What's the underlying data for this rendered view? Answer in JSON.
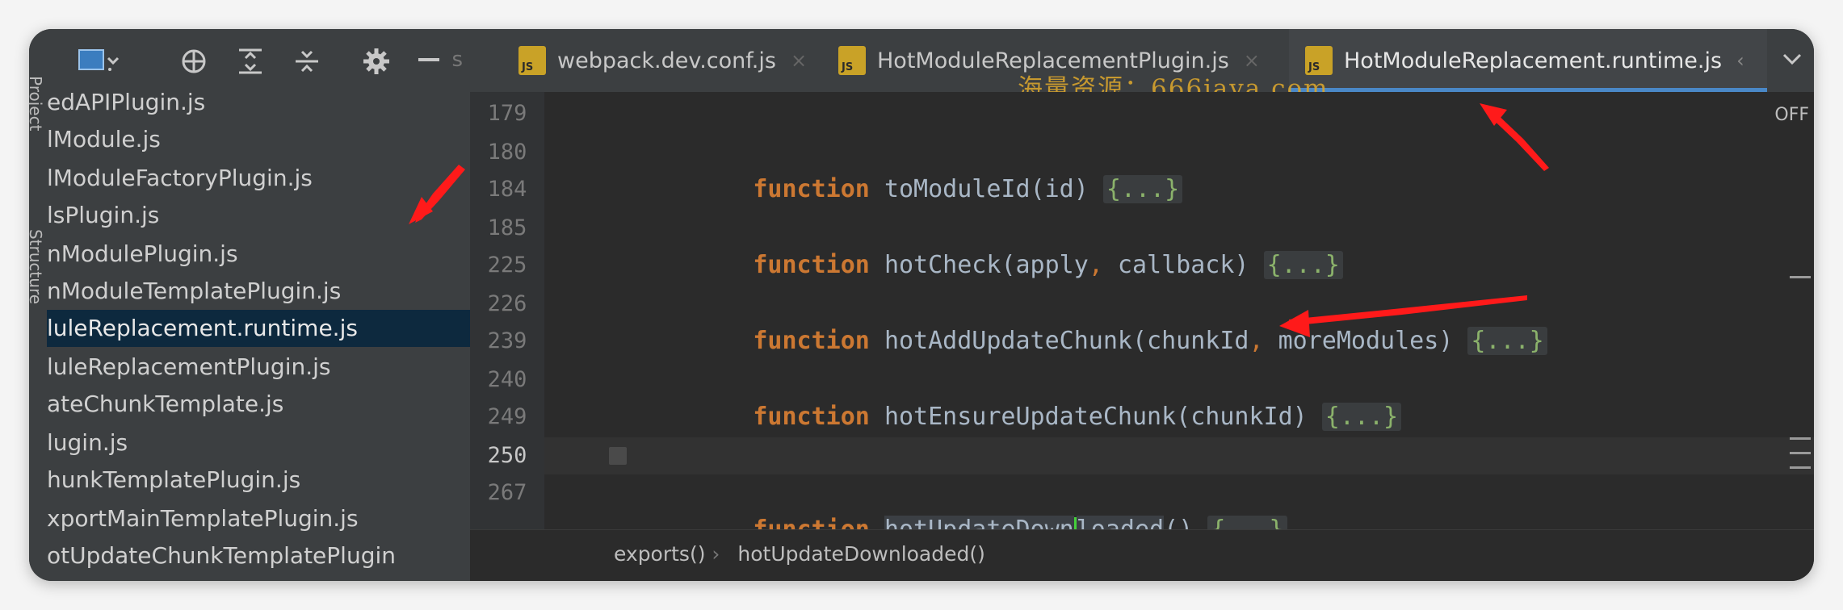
{
  "window": {
    "side_label_project": "Project",
    "side_label_structure": "Structure"
  },
  "toolbar": {
    "icons": [
      "window-icon",
      "crosshair-icon",
      "expand-icon",
      "collapse-icon",
      "gear-icon",
      "minus-icon"
    ],
    "hidden_tab_fragment": "s"
  },
  "tabs": [
    {
      "label": "webpack.dev.conf.js",
      "icon": "js-file-icon",
      "active": false
    },
    {
      "label": "HotModuleReplacementPlugin.js",
      "icon": "js-file-icon",
      "active": false
    },
    {
      "label": "HotModuleReplacement.runtime.js",
      "icon": "js-file-icon",
      "active": true
    }
  ],
  "js_badge": "JS",
  "watermark": "海量资源：666java.com",
  "editor_status": "OFF",
  "project_files": [
    "edAPIPlugin.js",
    "lModule.js",
    "lModuleFactoryPlugin.js",
    "lsPlugin.js",
    "nModulePlugin.js",
    "nModuleTemplatePlugin.js",
    "luleReplacement.runtime.js",
    "luleReplacementPlugin.js",
    "ateChunkTemplate.js",
    "lugin.js",
    "hunkTemplatePlugin.js",
    "xportMainTemplatePlugin.js",
    "otUpdateChunkTemplatePlugin"
  ],
  "selected_file_index": 6,
  "code_lines": [
    {
      "num": "179",
      "keyword": "",
      "name": "",
      "params": "",
      "fold": ""
    },
    {
      "num": "180",
      "keyword": "function",
      "name": "toModuleId",
      "params": "(id)",
      "fold": "{...}"
    },
    {
      "num": "184",
      "keyword": "",
      "name": "",
      "params": "",
      "fold": ""
    },
    {
      "num": "185",
      "keyword": "function",
      "name": "hotCheck",
      "params_a": "(apply",
      "params_b": " callback)",
      "fold": "{...}"
    },
    {
      "num": "225",
      "keyword": "",
      "name": "",
      "params": "",
      "fold": ""
    },
    {
      "num": "226",
      "keyword": "function",
      "name": "hotAddUpdateChunk",
      "params_a": "(chunkId",
      "params_b": " moreModules)",
      "fold": "{...}"
    },
    {
      "num": "239",
      "keyword": "",
      "name": "",
      "params": "",
      "fold": ""
    },
    {
      "num": "240",
      "keyword": "function",
      "name": "hotEnsureUpdateChunk",
      "params": "(chunkId)",
      "fold": "{...}"
    },
    {
      "num": "249",
      "keyword": "",
      "name": "",
      "params": "",
      "fold": ""
    },
    {
      "num": "250",
      "keyword": "function",
      "name_a": "hotUpdateDown",
      "name_b": "loaded",
      "params": "()",
      "fold": "{...}"
    },
    {
      "num": "267",
      "keyword": "",
      "name": "",
      "params": "",
      "fold": ""
    }
  ],
  "comma": ",",
  "breadcrumb": {
    "items": [
      "exports()",
      "hotUpdateDownloaded()"
    ],
    "separator": "›"
  },
  "colors": {
    "keyword": "#cc7832",
    "annotation_arrow": "#ff1a1a",
    "selection": "#0d293e",
    "active_tab_underline": "#4a88c7"
  }
}
